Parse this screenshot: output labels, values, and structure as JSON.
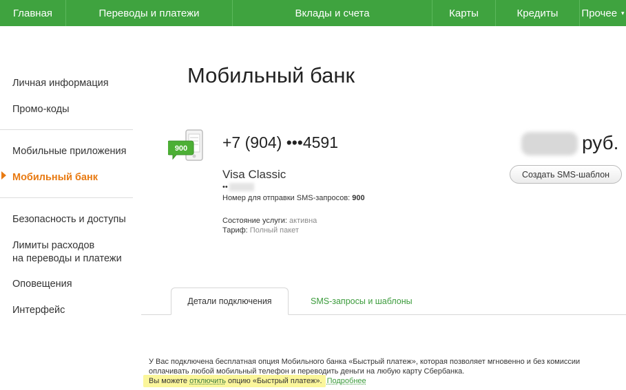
{
  "topnav": {
    "items": [
      {
        "label": "Главная"
      },
      {
        "label": "Переводы и платежи"
      },
      {
        "label": "Вклады и счета"
      },
      {
        "label": "Карты"
      },
      {
        "label": "Кредиты"
      },
      {
        "label": "Прочее",
        "chevron": "▾"
      }
    ]
  },
  "sidebar": {
    "items": [
      {
        "label": "Личная информация"
      },
      {
        "label": "Промо-коды"
      },
      {
        "label": "Мобильные приложения"
      },
      {
        "label": "Мобильный банк",
        "active": true
      },
      {
        "label": "Безопасность и доступы"
      },
      {
        "label_line1": "Лимиты расходов",
        "label_line2": "на переводы и платежи"
      },
      {
        "label": "Оповещения"
      },
      {
        "label": "Интерфейс"
      }
    ]
  },
  "page": {
    "title": "Мобильный банк"
  },
  "service": {
    "icon_badge": "900",
    "phone": "+7 (904) •••4591",
    "balance_currency": "руб.",
    "card_name": "Visa Classic",
    "card_number_mask": "••",
    "sms_number_label": "Номер для отправки SMS-запросов:",
    "sms_number_value": "900",
    "state_label": "Состояние услуги:",
    "state_value": "активна",
    "tariff_label": "Тариф:",
    "tariff_value": "Полный пакет",
    "create_template_button": "Создать SMS-шаблон"
  },
  "tabs": {
    "active": "Детали подключения",
    "other": "SMS-запросы и шаблоны"
  },
  "notice": {
    "text": "У Вас подключена бесплатная опция Мобильного банка «Быстрый платеж», которая позволяет мгновенно и без комиссии оплачивать любой мобильный телефон и переводить деньги на любую карту Сбербанка.",
    "hl_prefix": "Вы можете ",
    "hl_link": "отключить",
    "hl_suffix": " опцию «Быстрый платеж».",
    "more_link": "Подробнее"
  },
  "colors": {
    "brand_green": "#3fa33f",
    "active_orange": "#e87a12",
    "link_green": "#3b9b3b",
    "highlight": "#fbf69b"
  }
}
